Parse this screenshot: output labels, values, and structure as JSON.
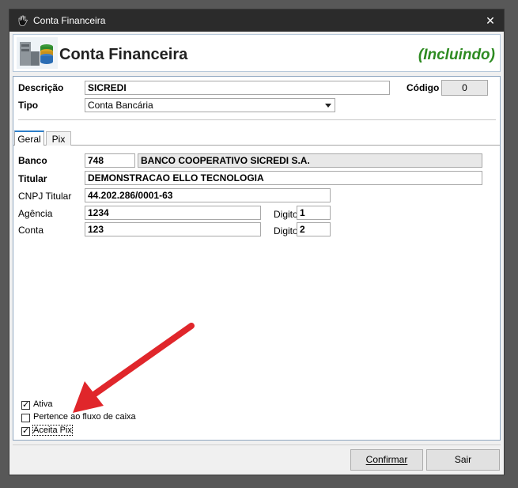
{
  "window": {
    "title": "Conta Financeira",
    "close_glyph": "✕",
    "app_icon": "hand-icon"
  },
  "header": {
    "title": "Conta Financeira",
    "status": "(Incluindo)",
    "status_color": "#2e8b22"
  },
  "form": {
    "descricao_label": "Descrição",
    "descricao_value": "SICREDI",
    "codigo_label": "Código",
    "codigo_value": "0",
    "tipo_label": "Tipo",
    "tipo_value": "Conta Bancária"
  },
  "tabs": [
    {
      "label": "Geral",
      "active": true
    },
    {
      "label": "Pix",
      "active": false
    }
  ],
  "geral": {
    "banco_label": "Banco",
    "banco_code": "748",
    "banco_name": "BANCO COOPERATIVO SICREDI S.A.",
    "titular_label": "Titular",
    "titular_value": "DEMONSTRACAO ELLO TECNOLOGIA",
    "cnpj_label": "CNPJ Titular",
    "cnpj_value": "44.202.286/0001-63",
    "agencia_label": "Agência",
    "agencia_value": "1234",
    "agencia_digito_label": "Digito",
    "agencia_digito_value": "1",
    "conta_label": "Conta",
    "conta_value": "123",
    "conta_digito_label": "Digito",
    "conta_digito_value": "2"
  },
  "checkboxes": [
    {
      "label": "Ativa",
      "checked": true
    },
    {
      "label": "Pertence ao fluxo de caixa",
      "checked": false
    },
    {
      "label": "Aceita Pix",
      "checked": true
    }
  ],
  "buttons": {
    "confirmar": "Confirmar",
    "sair": "Sair"
  },
  "annotation": {
    "arrow_color": "#e0262b"
  }
}
